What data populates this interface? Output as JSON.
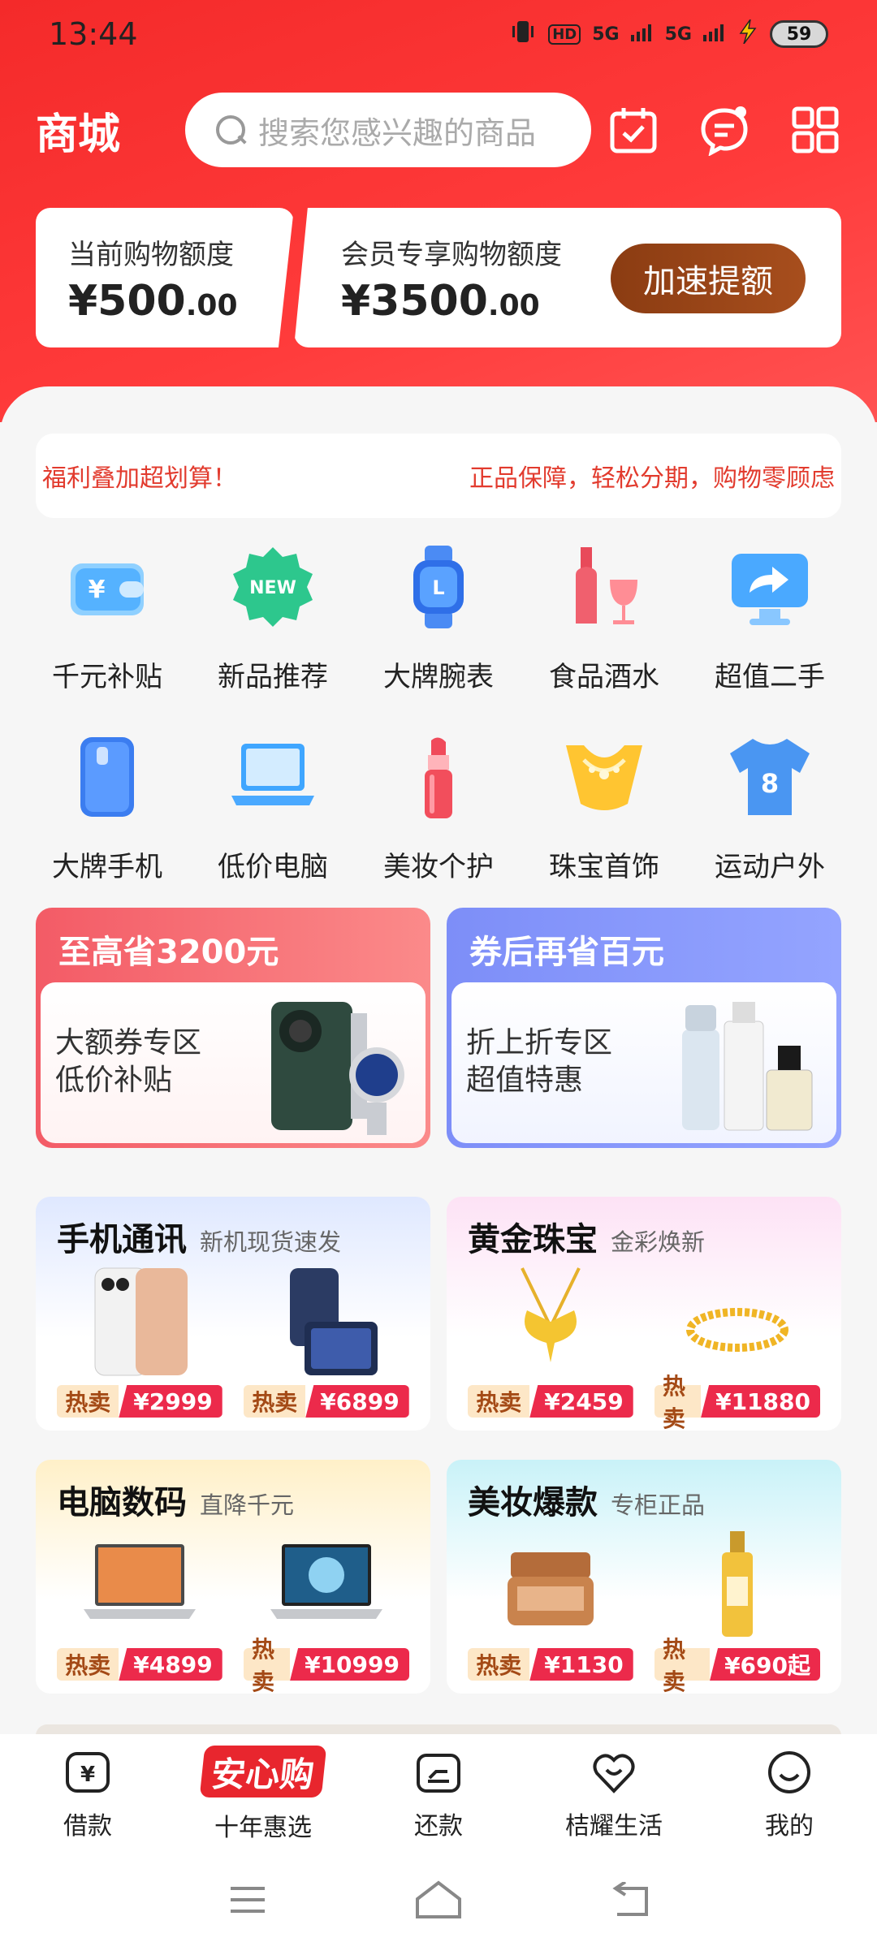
{
  "status_bar": {
    "time": "13:44",
    "hd": "HD",
    "net1": "5G",
    "net2": "5G",
    "battery": "59"
  },
  "header": {
    "title": "商城",
    "search_placeholder": "搜索您感兴趣的商品"
  },
  "credit": {
    "current_label": "当前购物额度",
    "current_amount": "¥500",
    "current_decimals": ".00",
    "member_label": "会员专享购物额度",
    "member_amount": "¥3500",
    "member_decimals": ".00",
    "boost_button": "加速提额"
  },
  "marquee": {
    "left_text": "福利叠加超划算！",
    "right_text": "正品保障，轻松分期，购物零顾虑"
  },
  "categories": [
    {
      "label": "千元补贴",
      "icon": "wallet-icon"
    },
    {
      "label": "新品推荐",
      "icon": "new-badge-icon"
    },
    {
      "label": "大牌腕表",
      "icon": "watch-icon"
    },
    {
      "label": "食品酒水",
      "icon": "wine-icon"
    },
    {
      "label": "超值二手",
      "icon": "monitor-arrow-icon"
    },
    {
      "label": "大牌手机",
      "icon": "phone-icon"
    },
    {
      "label": "低价电脑",
      "icon": "laptop-icon"
    },
    {
      "label": "美妆个护",
      "icon": "lipstick-icon"
    },
    {
      "label": "珠宝首饰",
      "icon": "necklace-icon"
    },
    {
      "label": "运动户外",
      "icon": "jersey-icon"
    }
  ],
  "promos": [
    {
      "title": "至高省3200元",
      "line1": "大额券专区",
      "line2": "低价补贴"
    },
    {
      "title": "券后再省百元",
      "line1": "折上折专区",
      "line2": "超值特惠"
    }
  ],
  "sections": [
    {
      "title": "手机通讯",
      "subtitle": "新机现货速发",
      "products": [
        {
          "hot": "热卖",
          "price": "¥2999"
        },
        {
          "hot": "热卖",
          "price": "¥6899"
        }
      ]
    },
    {
      "title": "黄金珠宝",
      "subtitle": "金彩焕新",
      "products": [
        {
          "hot": "热卖",
          "price": "¥2459"
        },
        {
          "hot": "热卖",
          "price": "¥11880"
        }
      ]
    },
    {
      "title": "电脑数码",
      "subtitle": "直降千元",
      "products": [
        {
          "hot": "热卖",
          "price": "¥4899"
        },
        {
          "hot": "热卖",
          "price": "¥10999"
        }
      ]
    },
    {
      "title": "美妆爆款",
      "subtitle": "专柜正品",
      "products": [
        {
          "hot": "热卖",
          "price": "¥1130"
        },
        {
          "hot": "热卖",
          "price": "¥690起"
        }
      ]
    }
  ],
  "bottom_nav": {
    "brand_badge": "安心购",
    "items": [
      {
        "label": "借款",
        "icon": "loan-icon"
      },
      {
        "label": "十年惠选",
        "icon": "brand-logo"
      },
      {
        "label": "还款",
        "icon": "repay-icon"
      },
      {
        "label": "桔耀生活",
        "icon": "heart-bag-icon"
      },
      {
        "label": "我的",
        "icon": "profile-smile-icon"
      }
    ]
  },
  "colors": {
    "header_red": "#f42a2a",
    "boost_brown": "#8b3c12",
    "price_red": "#ec2a4b",
    "marquee_red": "#e23b2e"
  }
}
